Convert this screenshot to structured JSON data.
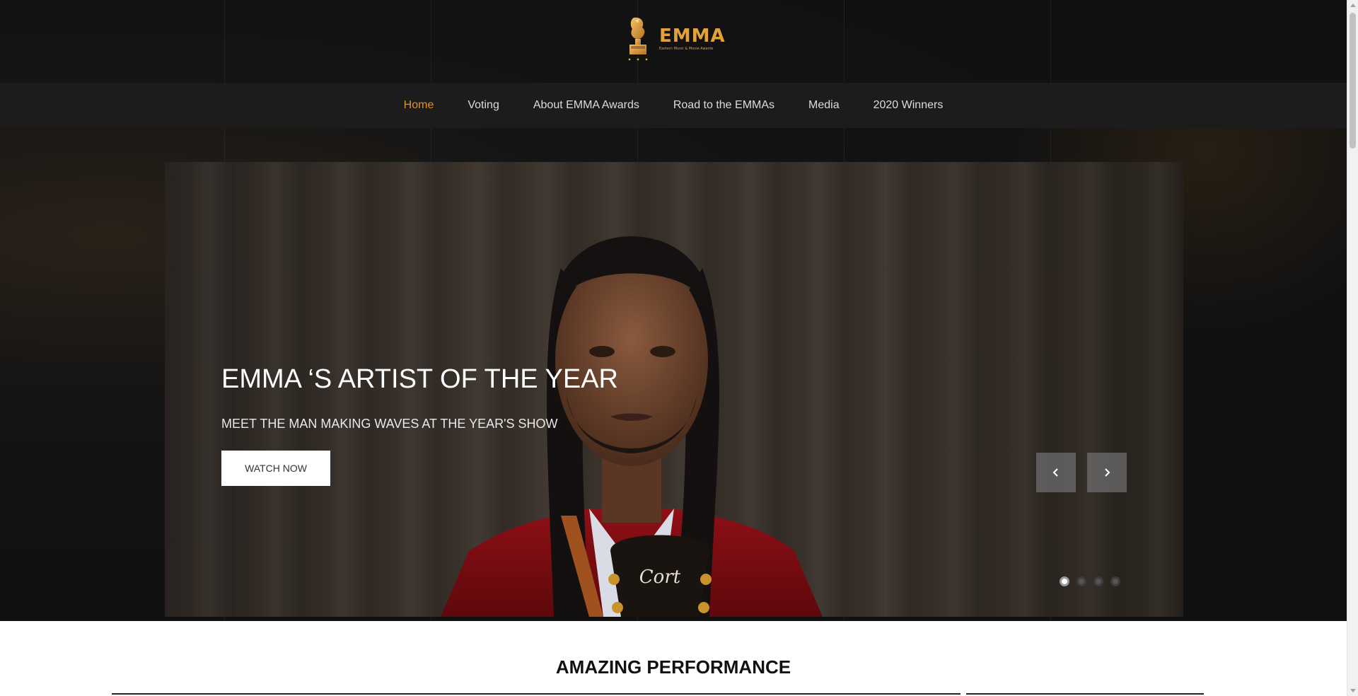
{
  "brand": {
    "name": "EMMA",
    "tagline": "Eastern Music & Movie Awards",
    "accent_color": "#e4a13a"
  },
  "nav": {
    "items": [
      {
        "label": "Home",
        "active": true
      },
      {
        "label": "Voting"
      },
      {
        "label": "About EMMA Awards"
      },
      {
        "label": "Road to the EMMAs"
      },
      {
        "label": "Media"
      },
      {
        "label": "2020 Winners"
      }
    ],
    "active_color": "#e48f2d"
  },
  "hero": {
    "title": "EMMA ‘S ARTIST OF THE YEAR",
    "subtitle": "MEET THE MAN MAKING WAVES AT THE YEAR'S SHOW",
    "button_label": "WATCH NOW",
    "prev_icon": "chevron-left-icon",
    "next_icon": "chevron-right-icon",
    "slide_count": 4,
    "active_slide": 1,
    "guitar_brand": "Cort"
  },
  "section": {
    "title": "AMAZING PERFORMANCE"
  }
}
